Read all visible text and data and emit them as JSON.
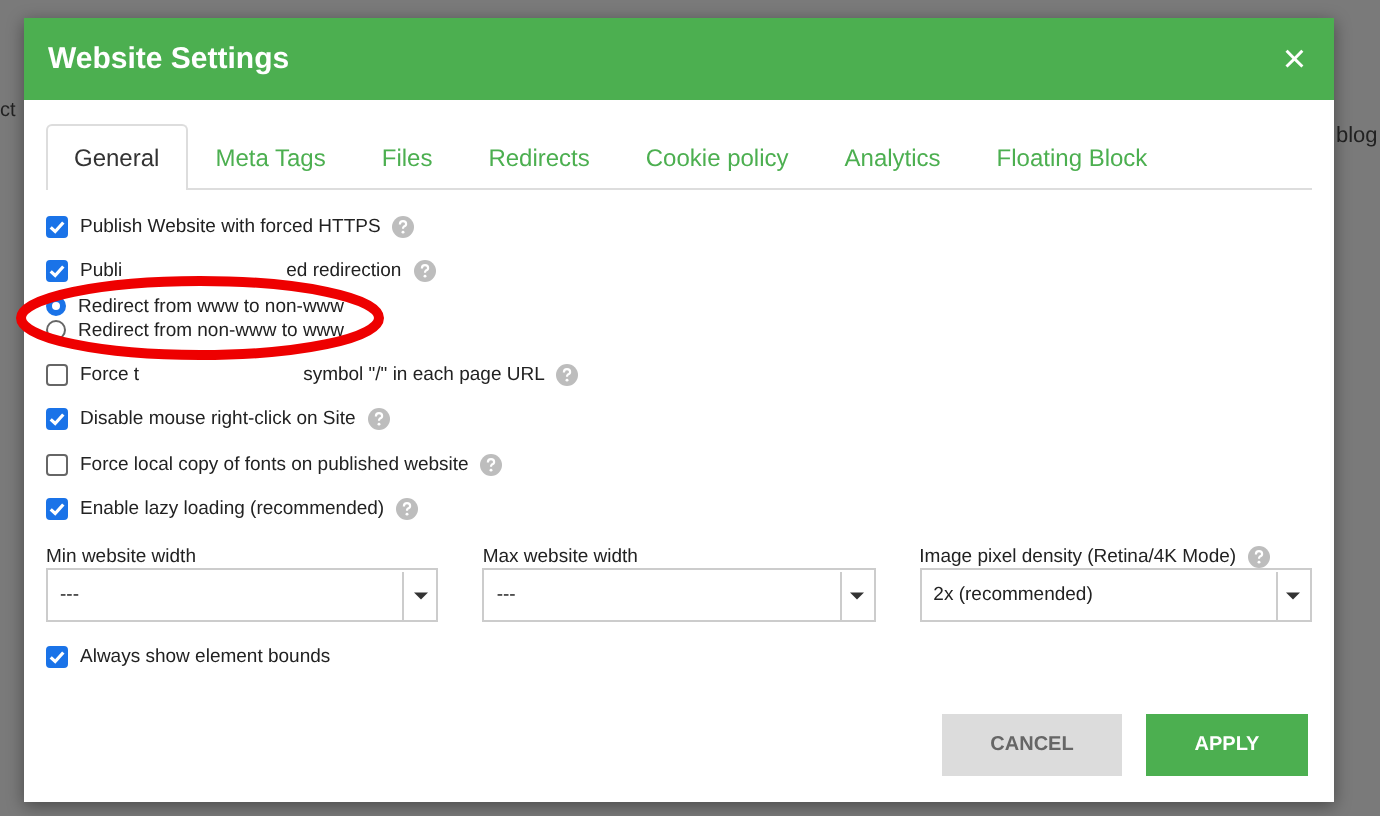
{
  "background": {
    "left_text": "ct",
    "right_text": "blog"
  },
  "window": {
    "title": "Website Settings",
    "close": "×"
  },
  "tabs": [
    {
      "label": "General",
      "selected": true
    },
    {
      "label": "Meta Tags",
      "selected": false
    },
    {
      "label": "Files",
      "selected": false
    },
    {
      "label": "Redirects",
      "selected": false
    },
    {
      "label": "Cookie policy",
      "selected": false
    },
    {
      "label": "Analytics",
      "selected": false
    },
    {
      "label": "Floating Block",
      "selected": false
    }
  ],
  "options": [
    {
      "kind": "checkbox",
      "label": "Publish Website with forced HTTPS",
      "checked": true,
      "help": true
    },
    {
      "kind": "checkbox",
      "label": "Publi",
      "label_after": "ed redirection",
      "checked": true,
      "help": true
    },
    {
      "kind": "radio",
      "label": "Redirect from www to non-www",
      "selected": true
    },
    {
      "kind": "radio",
      "label": "Redirect from non-www to www",
      "selected": false
    },
    {
      "kind": "checkbox",
      "label": "Force t",
      "label_after": "symbol \"/\" in each page URL",
      "checked": false,
      "help": true
    },
    {
      "kind": "checkbox",
      "label": "Disable mouse right-click on Site",
      "checked": true,
      "help": true
    },
    {
      "kind": "checkbox",
      "label": "Force local copy of fonts on published website",
      "checked": false,
      "help": true
    },
    {
      "kind": "checkbox",
      "label": "Enable lazy loading (recommended)",
      "checked": true,
      "help": true
    }
  ],
  "selects": [
    {
      "label": "Min website width",
      "value": "---",
      "help": false
    },
    {
      "label": "Max website width",
      "value": "---",
      "help": false
    },
    {
      "label": "Image pixel density (Retina/4K Mode)",
      "value": "2x (recommended)",
      "help": true
    }
  ],
  "bottom_option": {
    "label": "Always show element bounds",
    "checked": true
  },
  "buttons": [
    {
      "kind": "secondary",
      "label": "CANCEL"
    },
    {
      "kind": "primary",
      "label": "APPLY"
    }
  ]
}
